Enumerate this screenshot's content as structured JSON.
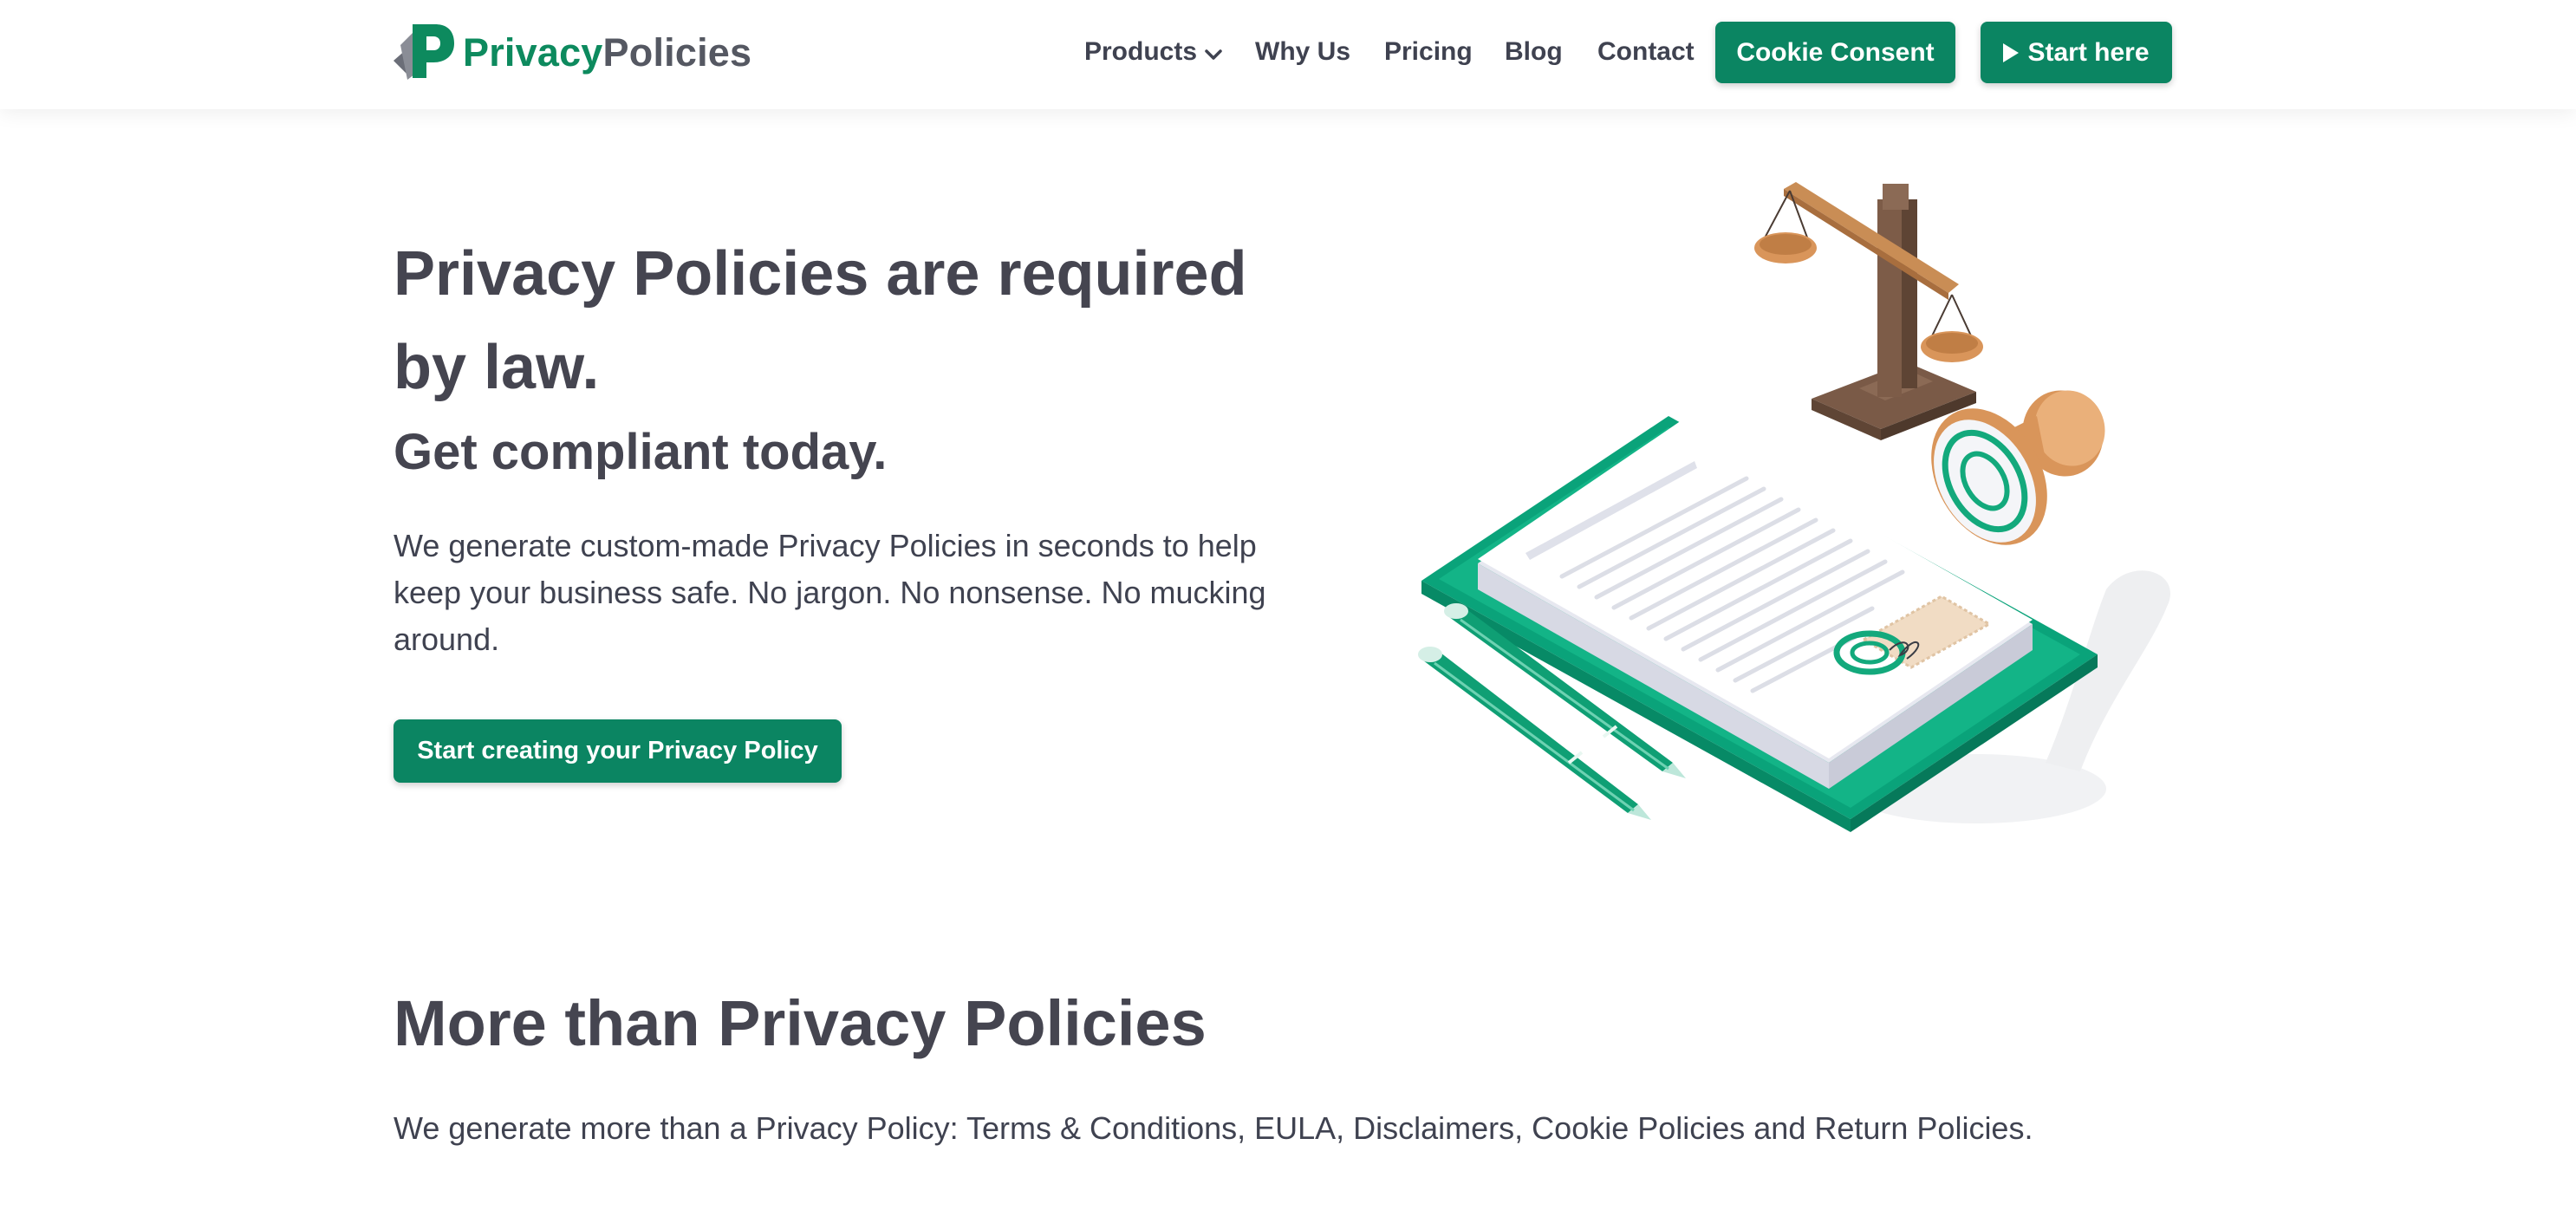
{
  "header": {
    "logo": {
      "part1": "Privacy",
      "part2": "Policies"
    },
    "nav": [
      {
        "label": "Products"
      },
      {
        "label": "Why Us"
      },
      {
        "label": "Pricing"
      },
      {
        "label": "Blog"
      },
      {
        "label": "Contact"
      }
    ],
    "cookie_button": "Cookie Consent",
    "start_button": "Start here"
  },
  "hero": {
    "title": "Privacy Policies are required by law.",
    "subtitle": "Get compliant today.",
    "text": "We generate custom-made Privacy Policies in seconds to help keep your business safe. No jargon. No nonsense. No mucking around.",
    "cta": "Start creating your Privacy Policy"
  },
  "more": {
    "title": "More than Privacy Policies",
    "text": "We generate more than a Privacy Policy: Terms & Conditions, EULA, Disclaimers, Cookie Policies and Return Policies."
  },
  "icons": {
    "logo": "privacy-policies-logo-icon",
    "products_dropdown": "chevron-down-icon",
    "start_here": "play-icon"
  },
  "colors": {
    "brand_green": "#0b8562",
    "text_dark": "#454550",
    "logo_gray": "#555862"
  }
}
